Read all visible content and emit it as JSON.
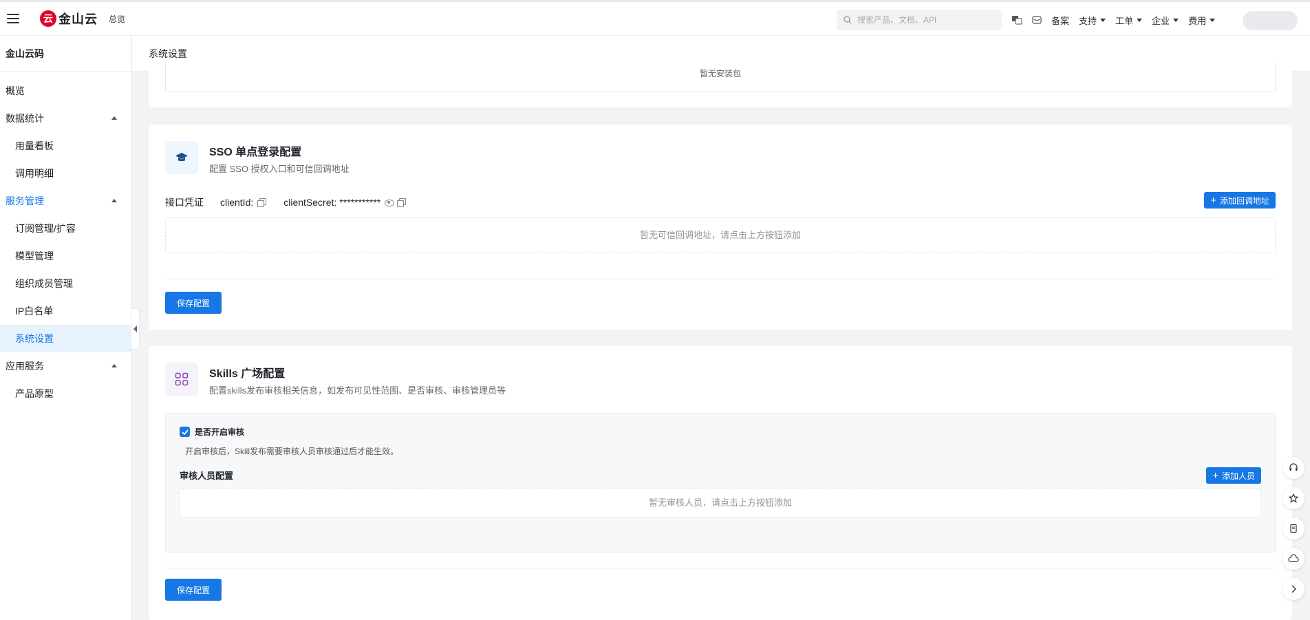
{
  "topbar": {
    "logo_text": "金山云",
    "logo_mark": "云",
    "overview_label": "总览",
    "search_placeholder": "搜索产品、文档、API",
    "nav": [
      "备案",
      "支持",
      "工单",
      "企业",
      "费用"
    ]
  },
  "sidebar": {
    "title": "金山云码",
    "items": [
      {
        "label": "概览"
      },
      {
        "label": "数据统计"
      },
      {
        "label": "用量看板"
      },
      {
        "label": "调用明细"
      },
      {
        "label": "服务管理"
      },
      {
        "label": "订阅管理/扩容"
      },
      {
        "label": "模型管理"
      },
      {
        "label": "组织成员管理"
      },
      {
        "label": "IP白名单"
      },
      {
        "label": "系统设置"
      },
      {
        "label": "应用服务"
      },
      {
        "label": "产品原型"
      }
    ]
  },
  "header": {
    "title": "系统设置"
  },
  "top_card": {
    "empty_text": "暂无安装包"
  },
  "sso": {
    "title": "SSO 单点登录配置",
    "desc": "配置 SSO 授权入口和可信回调地址",
    "cred_label": "接口凭证",
    "client_id_label": "clientId:",
    "client_secret_label": "clientSecret:",
    "client_secret_value": "***********",
    "add_callback_label": "添加回调地址",
    "empty_text": "暂无可信回调地址，请点击上方按钮添加",
    "save_label": "保存配置"
  },
  "skills": {
    "title": "Skills 广场配置",
    "desc": "配置skills发布审核相关信息，如发布可见性范围、是否审核、审核管理员等",
    "review_toggle_label": "是否开启审核",
    "review_note": "开启审核后，Skill发布需要审核人员审核通过后才能生效。",
    "reviewer_title": "审核人员配置",
    "add_member_label": "添加人员",
    "empty_text": "暂无审核人员，请点击上方按钮添加",
    "save_label": "保存配置"
  },
  "colors": {
    "accent": "#1677e5",
    "brand_red": "#e4002b",
    "active_bg": "#e6f3fe"
  },
  "icons": [
    "menu-icon",
    "search-icon",
    "translate-icon",
    "message-icon",
    "graduation-cap-icon",
    "grid-icon",
    "checkbox-checked-icon",
    "headset-icon",
    "star-icon",
    "document-icon",
    "cloud-icon",
    "chevron-right-icon"
  ]
}
